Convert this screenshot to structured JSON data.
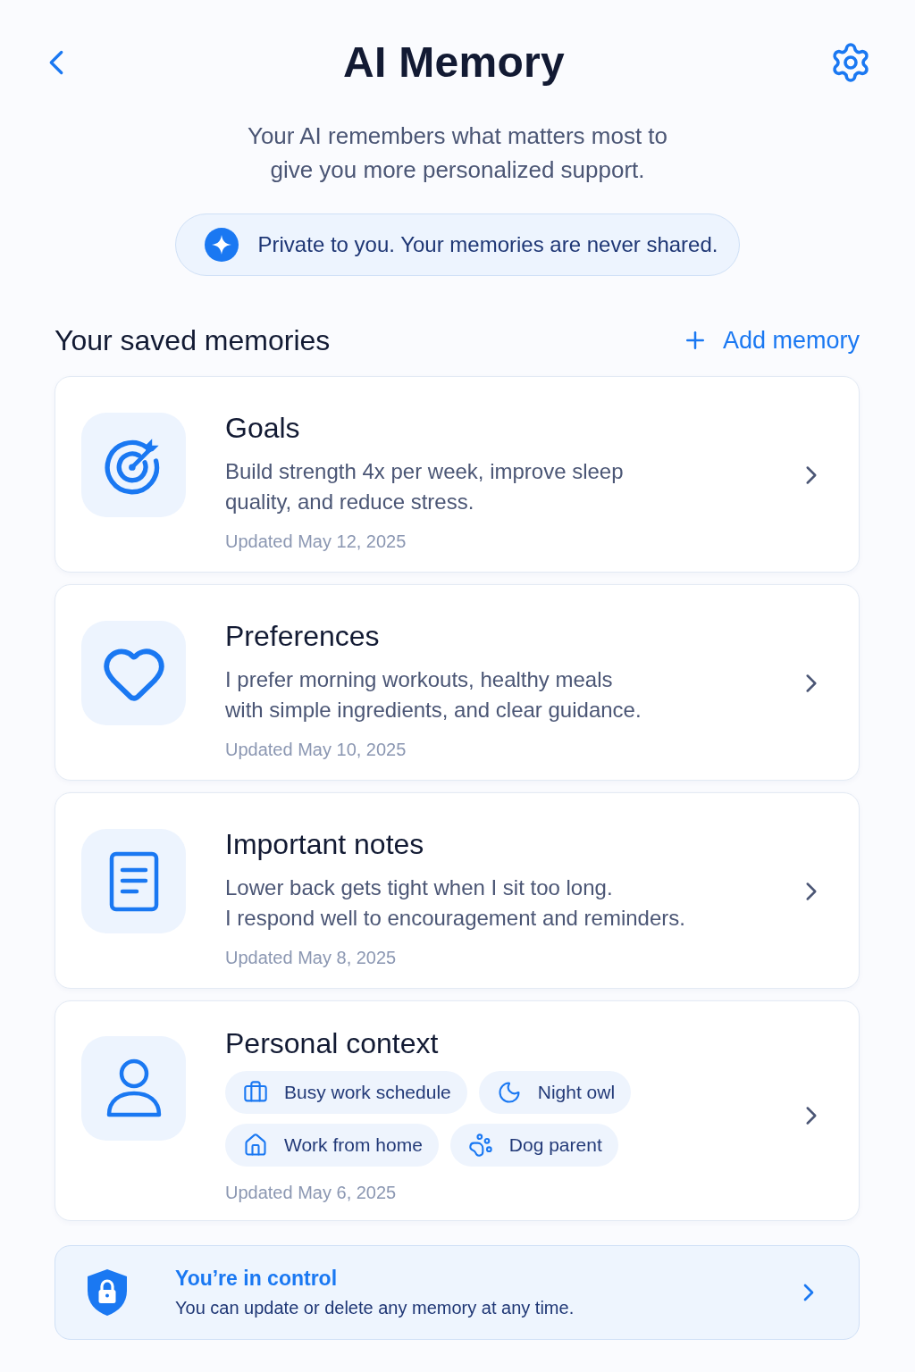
{
  "header": {
    "title": "AI Memory"
  },
  "intro": "Your AI remembers what matters most to\ngive you more personalized support.",
  "privacy_note": "Private to you. Your memories are never shared.",
  "section": {
    "title": "Your saved memories",
    "action": "Add memory"
  },
  "memories": [
    {
      "kind": "text",
      "title": "Goals",
      "description": "Build strength 4x per week, improve sleep\nquality, and reduce stress.",
      "updated": "Updated May 12, 2025"
    },
    {
      "kind": "text",
      "title": "Preferences",
      "description": "I prefer morning workouts, healthy meals\nwith simple ingredients, and clear guidance.",
      "updated": "Updated May 10, 2025"
    },
    {
      "kind": "text",
      "title": "Important notes",
      "description": "Lower back gets tight when I sit too long.\nI respond well to encouragement and reminders.",
      "updated": "Updated May 8, 2025"
    },
    {
      "kind": "tags",
      "title": "Personal context",
      "tags": [
        {
          "label": "Busy work schedule"
        },
        {
          "label": "Night owl"
        },
        {
          "label": "Work from home"
        },
        {
          "label": "Dog parent"
        }
      ],
      "updated": "Updated May 6, 2025"
    }
  ],
  "control_banner": {
    "title": "You’re in control",
    "text": "You can update or delete any memory at any time."
  }
}
